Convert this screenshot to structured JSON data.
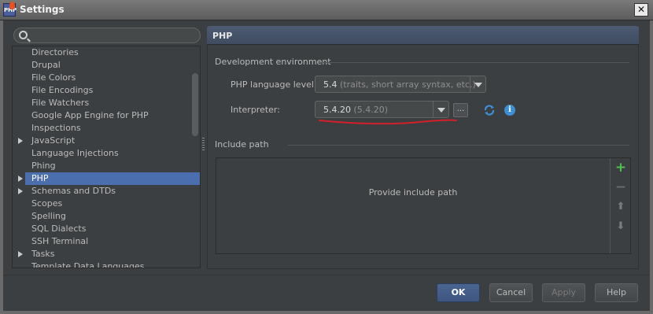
{
  "window": {
    "title": "Settings",
    "close_glyph": "✕",
    "icon_text": "PHP"
  },
  "search": {
    "placeholder": "",
    "value": ""
  },
  "tree": {
    "items": [
      {
        "label": "Directories",
        "expandable": false
      },
      {
        "label": "Drupal",
        "expandable": false
      },
      {
        "label": "File Colors",
        "expandable": false
      },
      {
        "label": "File Encodings",
        "expandable": false
      },
      {
        "label": "File Watchers",
        "expandable": false
      },
      {
        "label": "Google App Engine for PHP",
        "expandable": false
      },
      {
        "label": "Inspections",
        "expandable": false
      },
      {
        "label": "JavaScript",
        "expandable": true
      },
      {
        "label": "Language Injections",
        "expandable": false
      },
      {
        "label": "Phing",
        "expandable": false
      },
      {
        "label": "PHP",
        "expandable": true,
        "selected": true
      },
      {
        "label": "Schemas and DTDs",
        "expandable": true
      },
      {
        "label": "Scopes",
        "expandable": false
      },
      {
        "label": "Spelling",
        "expandable": false
      },
      {
        "label": "SQL Dialects",
        "expandable": false
      },
      {
        "label": "SSH Terminal",
        "expandable": false
      },
      {
        "label": "Tasks",
        "expandable": true
      },
      {
        "label": "Template Data Languages",
        "expandable": false
      }
    ]
  },
  "panel": {
    "title": "PHP",
    "dev_env": {
      "group_title": "Development environment",
      "language_level_label": "PHP language level:",
      "language_level_value": "5.4",
      "language_level_hint": "(traits, short array syntax, etc.)",
      "interpreter_label": "Interpreter:",
      "interpreter_value": "5.4.20",
      "interpreter_hint": "(5.4.20)",
      "browse_label": "..."
    },
    "include_path": {
      "group_title": "Include path",
      "empty_text": "Provide include path",
      "add_glyph": "+",
      "remove_glyph": "−",
      "up_glyph": "⬆",
      "down_glyph": "⬇"
    }
  },
  "footer": {
    "ok": "OK",
    "cancel": "Cancel",
    "apply": "Apply",
    "help": "Help"
  },
  "colors": {
    "accent": "#4b6eaf",
    "add": "#4fbf4f",
    "annotation": "#d3202a",
    "info": "#3d8fd8"
  }
}
